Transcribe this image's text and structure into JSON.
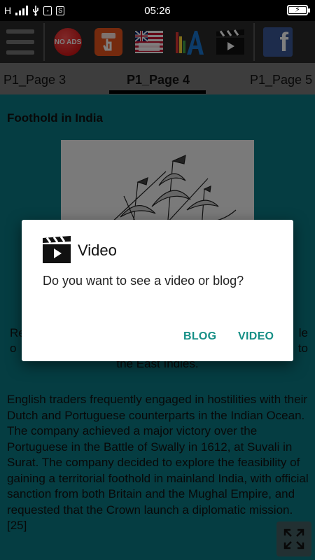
{
  "status_bar": {
    "network_type": "H",
    "time": "05:26",
    "battery_level": 1.0,
    "icons": [
      "signal-icon",
      "usb-icon",
      "notification-icon",
      "sim-icon",
      "battery-charging-icon"
    ]
  },
  "toolbar": {
    "no_ads_label": "NO ADS",
    "flag_caption": "East India Company",
    "icons": [
      "menu-icon",
      "no-ads-icon",
      "tap-icon",
      "east-india-flag-icon",
      "font-icon",
      "video-clapper-icon",
      "facebook-icon"
    ]
  },
  "tabs": [
    {
      "label": "P1_Page 3",
      "active": false
    },
    {
      "label": "P1_Page 4",
      "active": true
    },
    {
      "label": "P1_Page 5",
      "active": false
    }
  ],
  "article": {
    "title": "Foothold in India",
    "caption_left_visible": "Re",
    "caption_right_visible": "le",
    "caption_line2_left": "o",
    "caption_line2_right": "to",
    "caption_line3": "the East Indies.",
    "body": "English traders frequently engaged in hostilities with their Dutch and Portuguese counterparts in the Indian Ocean. The company achieved a major victory over the Portuguese in the Battle of Swally in 1612, at Suvali in Surat. The company decided to explore the feasibility of gaining a territorial foothold in mainland India, with official sanction from both Britain and the Mughal Empire, and requested that the Crown launch a diplomatic mission.[25]"
  },
  "dialog": {
    "title": "Video",
    "message": "Do you want to see a video or blog?",
    "blog_button": "BLOG",
    "video_button": "VIDEO"
  },
  "colors": {
    "content_bg": "#0a7a85",
    "toolbar_bg": "#2b2b2b",
    "tabs_bg": "#7a7a7a",
    "dialog_accent": "#168f86"
  }
}
